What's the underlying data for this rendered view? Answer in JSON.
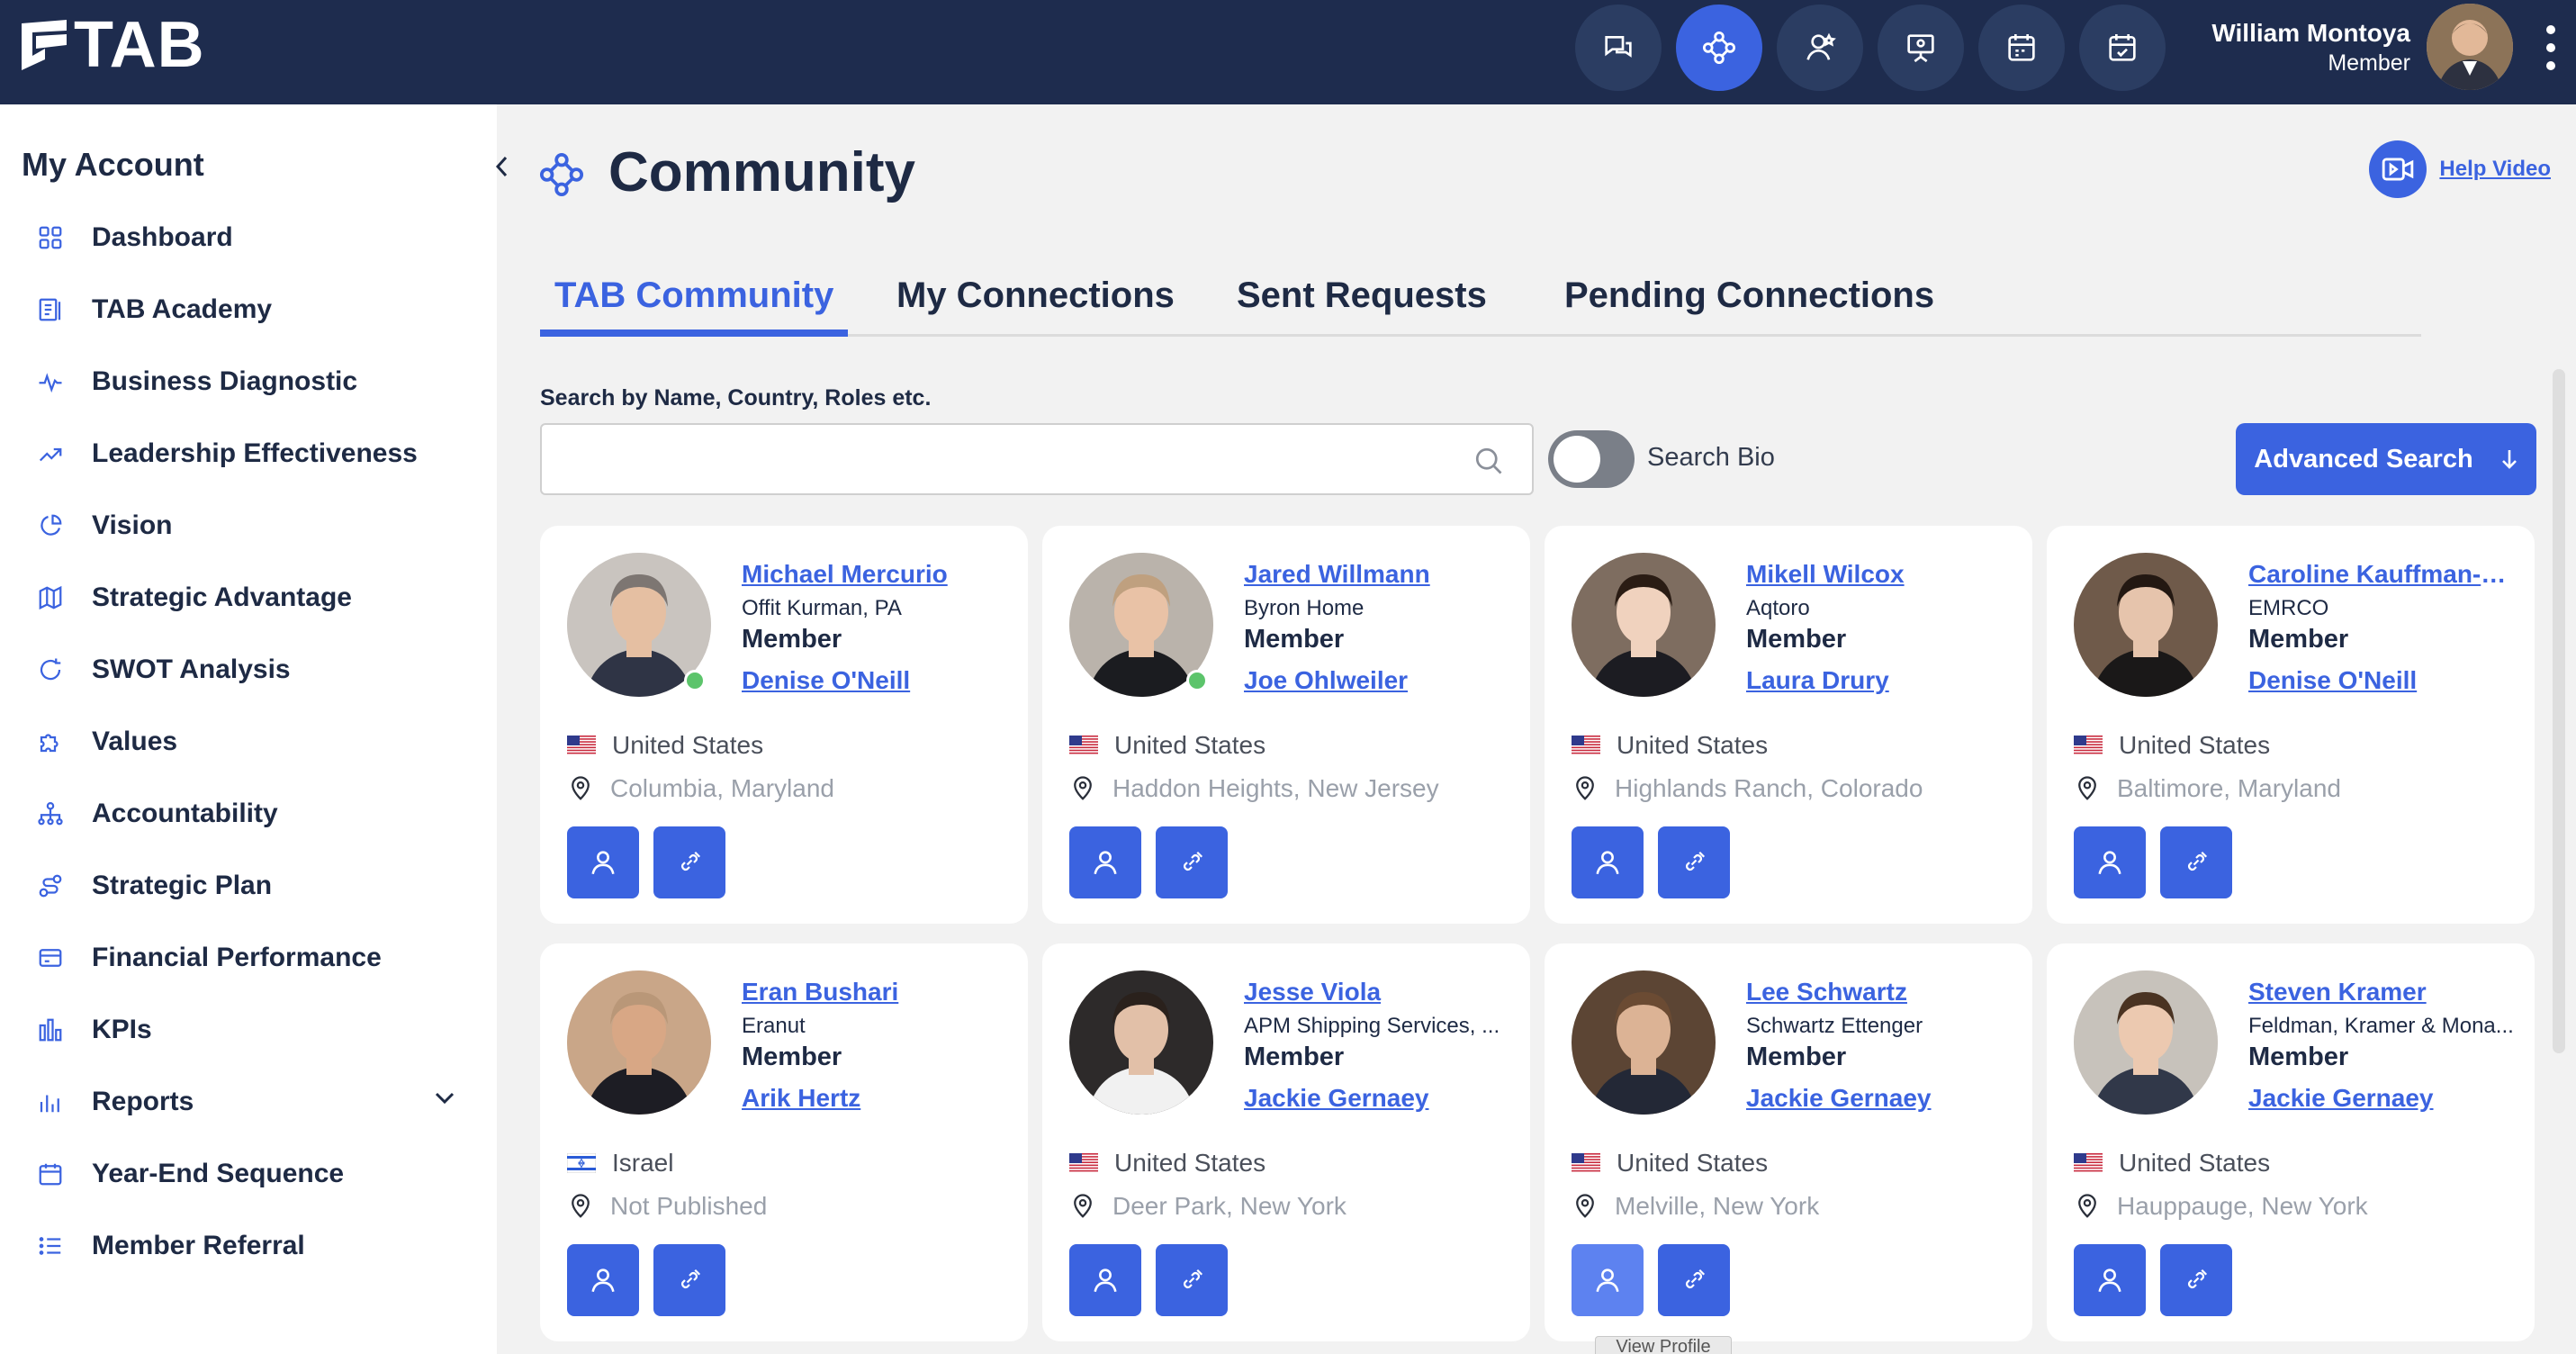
{
  "brand": {
    "logo_text": "TAB"
  },
  "user": {
    "name": "William Montoya",
    "role": "Member"
  },
  "sidebar": {
    "heading": "My Account",
    "items": [
      {
        "label": "Dashboard",
        "icon": "grid-icon"
      },
      {
        "label": "TAB Academy",
        "icon": "academy-icon"
      },
      {
        "label": "Business Diagnostic",
        "icon": "pulse-icon"
      },
      {
        "label": "Leadership Effectiveness",
        "icon": "trend-up-icon"
      },
      {
        "label": "Vision",
        "icon": "pie-icon"
      },
      {
        "label": "Strategic Advantage",
        "icon": "map-icon"
      },
      {
        "label": "SWOT Analysis",
        "icon": "refresh-icon"
      },
      {
        "label": "Values",
        "icon": "puzzle-icon"
      },
      {
        "label": "Accountability",
        "icon": "org-chart-icon"
      },
      {
        "label": "Strategic Plan",
        "icon": "route-icon"
      },
      {
        "label": "Financial Performance",
        "icon": "card-icon"
      },
      {
        "label": "KPIs",
        "icon": "bars-icon"
      },
      {
        "label": "Reports",
        "icon": "report-bars-icon"
      },
      {
        "label": "Year-End Sequence",
        "icon": "calendar-icon"
      },
      {
        "label": "Member Referral",
        "icon": "list-icon"
      }
    ]
  },
  "page": {
    "title": "Community",
    "help_video": "Help Video"
  },
  "tabs": [
    "TAB Community",
    "My Connections",
    "Sent Requests",
    "Pending Connections"
  ],
  "search": {
    "label": "Search by Name, Country, Roles etc.",
    "value": "",
    "placeholder": "",
    "toggle_label": "Search Bio",
    "advanced_label": "Advanced Search"
  },
  "members": [
    {
      "name": "Michael Mercurio",
      "company": "Offit Kurman, PA",
      "role": "Member",
      "chair": "Denise O'Neill",
      "country": "United States",
      "city": "Columbia, Maryland",
      "online": true,
      "flag": "us"
    },
    {
      "name": "Jared Willmann",
      "company": "Byron Home",
      "role": "Member",
      "chair": "Joe Ohlweiler",
      "country": "United States",
      "city": "Haddon Heights, New Jersey",
      "online": true,
      "flag": "us"
    },
    {
      "name": "Mikell Wilcox",
      "company": "Aqtoro",
      "role": "Member",
      "chair": "Laura Drury",
      "country": "United States",
      "city": "Highlands Ranch, Colorado",
      "online": false,
      "flag": "us"
    },
    {
      "name": "Caroline Kauffman-K...",
      "company": "EMRCO",
      "role": "Member",
      "chair": "Denise O'Neill",
      "country": "United States",
      "city": "Baltimore, Maryland",
      "online": false,
      "flag": "us"
    },
    {
      "name": "Eran Bushari",
      "company": "Eranut",
      "role": "Member",
      "chair": "Arik Hertz",
      "country": "Israel",
      "city": "Not Published",
      "online": false,
      "flag": "il"
    },
    {
      "name": "Jesse Viola",
      "company": "APM Shipping Services, ...",
      "role": "Member",
      "chair": "Jackie Gernaey",
      "country": "United States",
      "city": "Deer Park, New York",
      "online": false,
      "flag": "us"
    },
    {
      "name": "Lee Schwartz",
      "company": "Schwartz Ettenger",
      "role": "Member",
      "chair": "Jackie Gernaey",
      "country": "United States",
      "city": "Melville, New York",
      "online": false,
      "flag": "us"
    },
    {
      "name": "Steven Kramer",
      "company": "Feldman, Kramer & Mona...",
      "role": "Member",
      "chair": "Jackie Gernaey",
      "country": "United States",
      "city": "Hauppauge, New York",
      "online": false,
      "flag": "us"
    }
  ],
  "tooltip": "View Profile",
  "colors": {
    "navy": "#1e2c4e",
    "accent": "#3b63e0",
    "online": "#5cc46b"
  }
}
